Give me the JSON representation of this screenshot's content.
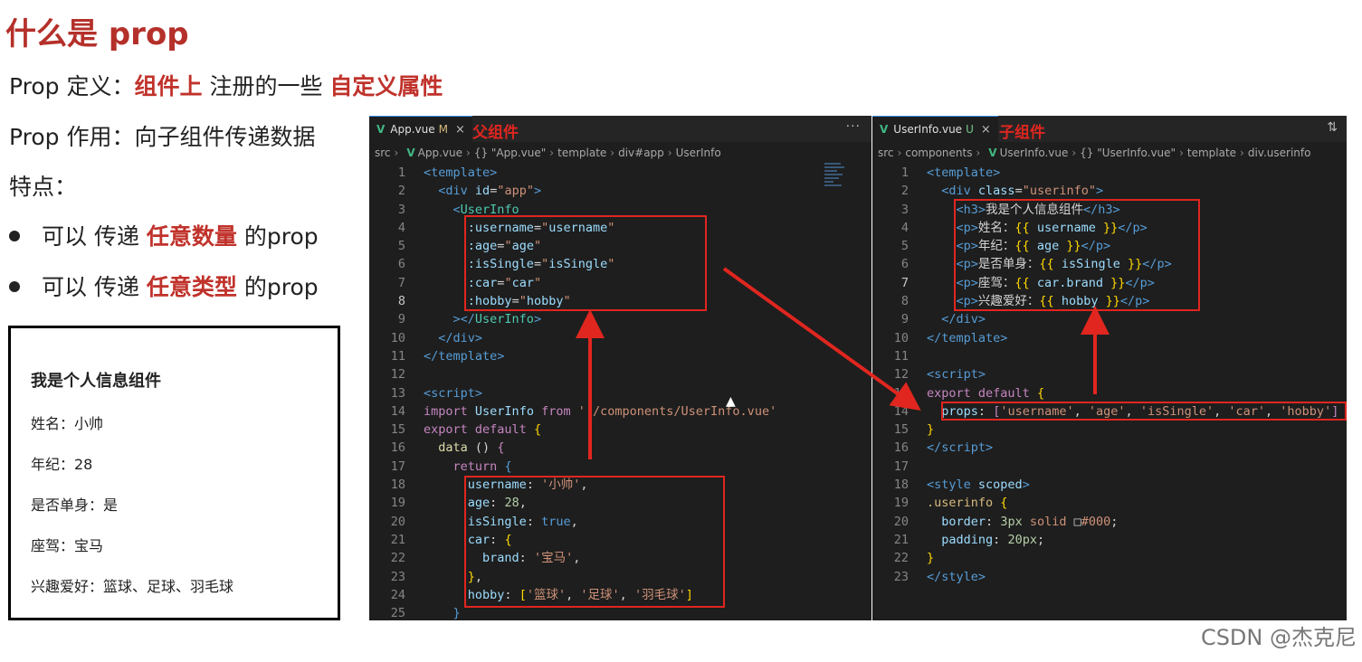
{
  "title": "什么是 prop",
  "definition": {
    "label": "Prop 定义：",
    "h1": "组件上",
    "mid": " 注册的一些 ",
    "h2": "自定义属性"
  },
  "purpose": {
    "label": "Prop 作用：",
    "text": "向子组件传递数据"
  },
  "features_label": "特点：",
  "bullets": [
    {
      "pre": "可以 传递 ",
      "hl": "任意数量",
      "post": " 的prop"
    },
    {
      "pre": "可以 传递 ",
      "hl": "任意类型",
      "post": " 的prop"
    }
  ],
  "preview": {
    "heading": "我是个人信息组件",
    "lines": [
      "姓名：小帅",
      "年纪：28",
      "是否单身：是",
      "座驾：宝马",
      "兴趣爱好：篮球、足球、羽毛球"
    ]
  },
  "left_editor": {
    "tab": "App.vue",
    "tab_mod": "M",
    "tab_close": "×",
    "note": "父组件",
    "more": "···",
    "crumbs": [
      "src",
      "App.vue",
      "{} \"App.vue\"",
      "template",
      "div#app",
      "UserInfo"
    ]
  },
  "right_editor": {
    "tab": "UserInfo.vue",
    "tab_mod": "U",
    "tab_close": "×",
    "note": "子组件",
    "compare": "⇅",
    "crumbs": [
      "src",
      "components",
      "UserInfo.vue",
      "{} \"UserInfo.vue\"",
      "template",
      "div.userinfo"
    ]
  },
  "watermark": "CSDN @杰克尼",
  "colors": {
    "highlight": "#c0322b",
    "annotation": "#e0261f",
    "editor_bg": "#1e1e1e",
    "vue_green": "#41b883"
  }
}
